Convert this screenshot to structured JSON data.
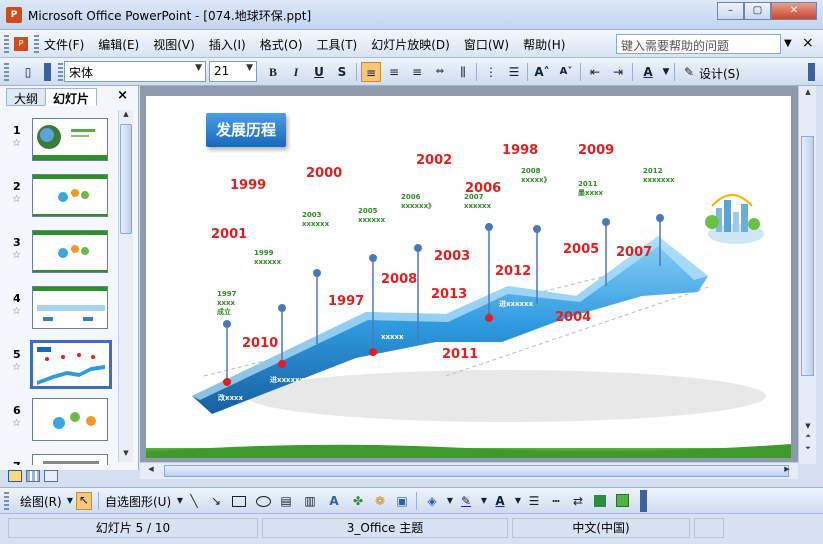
{
  "window": {
    "title": "Microsoft Office PowerPoint - [074.地球环保.ppt]",
    "app_icon_letter": "P",
    "minimize": "–",
    "maximize": "▢",
    "close": "✕"
  },
  "menubar": {
    "items": [
      "文件(F)",
      "编辑(E)",
      "视图(V)",
      "插入(I)",
      "格式(O)",
      "工具(T)",
      "幻灯片放映(D)",
      "窗口(W)",
      "帮助(H)"
    ],
    "help_placeholder": "键入需要帮助的问题",
    "doc_close": "×"
  },
  "toolbar": {
    "font_name": "宋体",
    "font_size": "21",
    "bold": "B",
    "italic": "I",
    "underline": "U",
    "shadow": "S",
    "font_color_glyph": "A",
    "design_label": "设计(S)"
  },
  "leftpane": {
    "tabs": [
      "大纲",
      "幻灯片"
    ],
    "close": "×",
    "slides": [
      {
        "num": "1"
      },
      {
        "num": "2"
      },
      {
        "num": "3"
      },
      {
        "num": "4"
      },
      {
        "num": "5",
        "selected": true
      },
      {
        "num": "6"
      },
      {
        "num": "7"
      }
    ]
  },
  "slide": {
    "title": "发展历程",
    "years": [
      {
        "text": "1999"
      },
      {
        "text": "2000"
      },
      {
        "text": "2002"
      },
      {
        "text": "1998"
      },
      {
        "text": "2009"
      },
      {
        "text": "2001"
      },
      {
        "text": "2006"
      },
      {
        "text": "2003"
      },
      {
        "text": "2008"
      },
      {
        "text": "2012"
      },
      {
        "text": "2005"
      },
      {
        "text": "2007"
      },
      {
        "text": "1997"
      },
      {
        "text": "2013"
      },
      {
        "text": "2010"
      },
      {
        "text": "2004"
      },
      {
        "text": "2011"
      }
    ],
    "notes": [
      {
        "lines": [
          "1997",
          "xxxx",
          "成立"
        ]
      },
      {
        "lines": [
          "1999",
          "xxxxxx"
        ]
      },
      {
        "lines": [
          "2003",
          "xxxxxx"
        ]
      },
      {
        "lines": [
          "2005",
          "xxxxxx"
        ]
      },
      {
        "lines": [
          "2006",
          "xxxxxx》"
        ]
      },
      {
        "lines": [
          "2007",
          "xxxxxx"
        ]
      },
      {
        "lines": [
          "2008",
          "xxxxx》"
        ]
      },
      {
        "lines": [
          "2011",
          "墨xxxx"
        ]
      },
      {
        "lines": [
          "2012",
          "xxxxxxx"
        ]
      }
    ],
    "ribbon_labels": [
      "改xxxx",
      "进xxxxxx",
      "xxxxx",
      "进xxxxxx"
    ]
  },
  "drawbar": {
    "draw_menu": "绘图(R)",
    "autoshapes": "自选图形(U)"
  },
  "statusbar": {
    "slide_pos": "幻灯片 5 / 10",
    "theme": "3_Office 主题",
    "language": "中文(中国)"
  },
  "colors": {
    "year_red": "#e02020",
    "note_green": "#2d8c22",
    "ribbon_blue": "#2f9ae0",
    "title_blue": "#1868b8"
  }
}
